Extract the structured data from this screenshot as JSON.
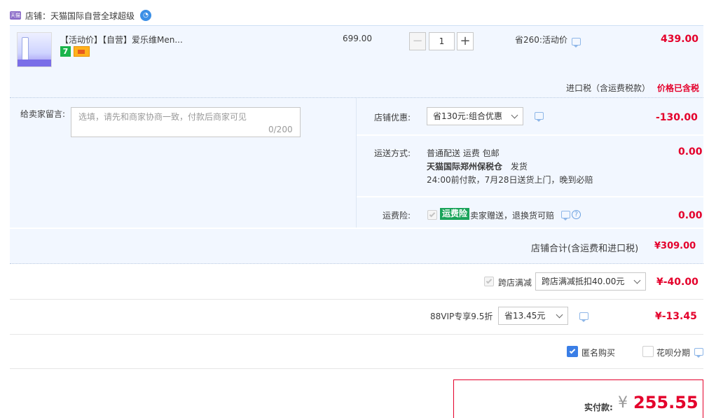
{
  "shop": {
    "logo_text": "天猫",
    "name": "店铺：天猫国际自营全球超级",
    "ww_icon": "wangwang-chat-icon"
  },
  "item": {
    "title": "【活动价】【自营】爱乐维Men...",
    "badges": [
      "7-day-return-icon",
      "card-payment-icon"
    ],
    "original_price": "699.00",
    "quantity": "1",
    "qty_minus": "−",
    "qty_plus": "+",
    "saving": "省260:活动价",
    "price": "439.00",
    "tax_label": "进口税（含运费税款）",
    "tax_value": "价格已含税"
  },
  "message": {
    "label": "给卖家留言:",
    "placeholder": "选填，请先和商家协商一致，付款后商家可见",
    "count": "0/200"
  },
  "shop_discount": {
    "label": "店铺优惠:",
    "selected": "省130元:组合优惠",
    "amount": "-130.00"
  },
  "shipping": {
    "label": "运送方式:",
    "line1": "普通配送 运费 包邮",
    "line2_bold": "天猫国际郑州保税仓",
    "line2_rest": "发货",
    "line3": "24:00前付款，7月28日送货上门，晚到必赔",
    "amount": "0.00"
  },
  "insurance": {
    "label": "运费险:",
    "tag": "运费险",
    "text": "卖家赠送，退换货可赔",
    "help": "?",
    "amount": "0.00"
  },
  "subtotal": {
    "label": "店铺合计(含运费和进口税)",
    "value": "¥309.00"
  },
  "cross_store": {
    "checkbox_label": "跨店满减",
    "selected": "跨店满减抵扣40.00元",
    "amount": "¥-40.00"
  },
  "vip": {
    "label": "88VIP专享9.5折",
    "selected": "省13.45元",
    "amount": "¥-13.45"
  },
  "options": {
    "anonymous": "匿名购买",
    "anonymous_checked": true,
    "huabei": "花呗分期",
    "huabei_checked": false
  },
  "total": {
    "label": "实付款:",
    "yen": "¥",
    "value": "255.55"
  },
  "colors": {
    "accent_red": "#e4002b",
    "panel_blue": "#f2f7ff",
    "checkbox_blue": "#3a7ee6",
    "insurance_green": "#1aa35a"
  }
}
